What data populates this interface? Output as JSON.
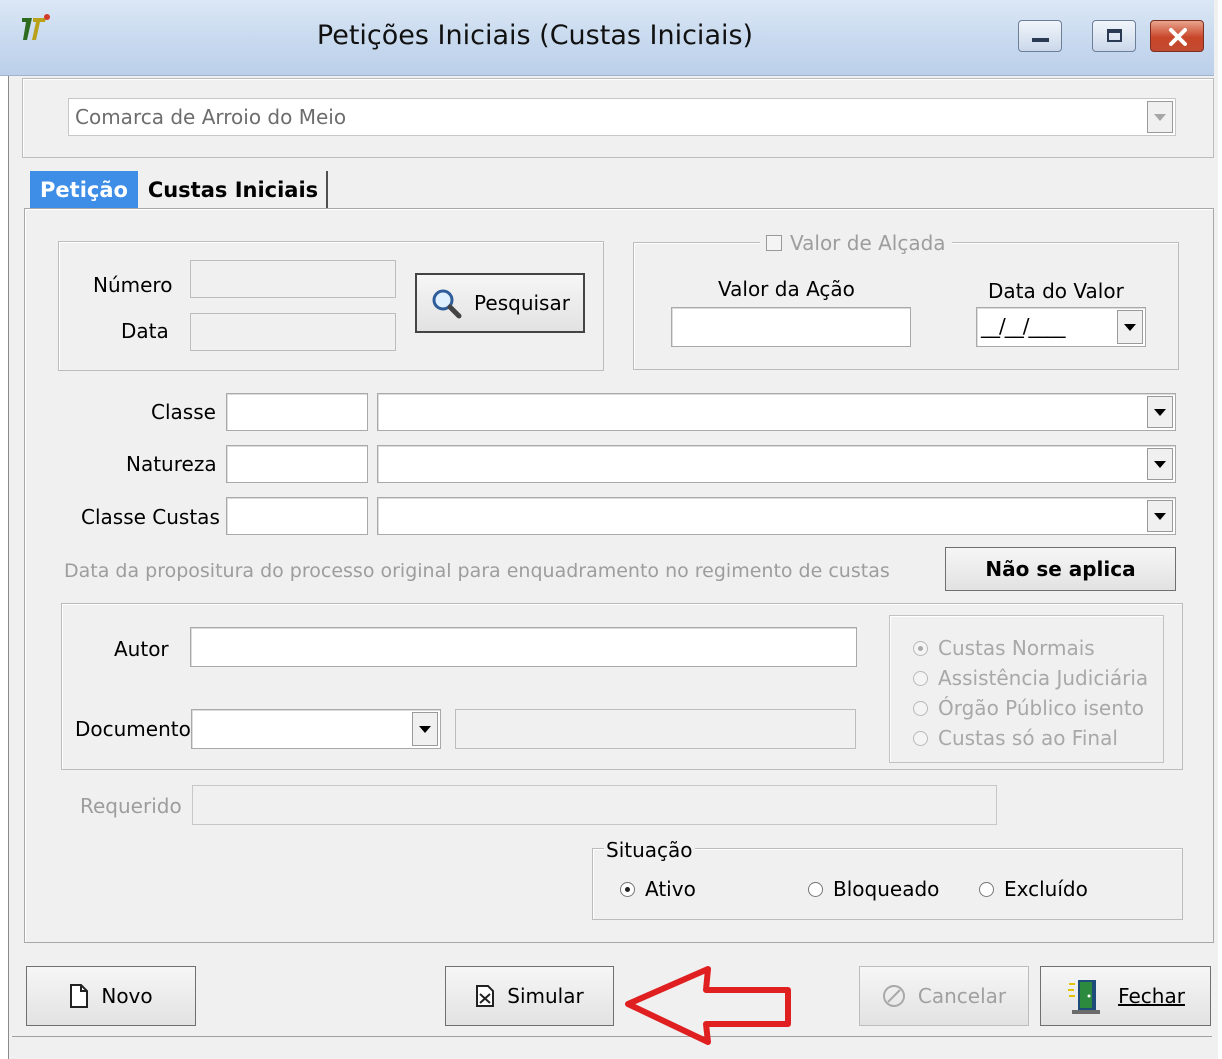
{
  "window": {
    "title": "Petições Iniciais (Custas Iniciais)"
  },
  "comarca": {
    "value": "Comarca de Arroio do Meio"
  },
  "tabs": [
    {
      "label": "Petição"
    },
    {
      "label": "Custas Iniciais"
    }
  ],
  "peticao": {
    "numero_label": "Número",
    "data_label": "Data",
    "pesquisar_label": "Pesquisar",
    "valor_alcada_label": "Valor de Alçada",
    "valor_acao_label": "Valor da Ação",
    "data_valor_label": "Data do Valor",
    "data_valor_value": "__/__/____",
    "classe_label": "Classe",
    "natureza_label": "Natureza",
    "classe_custas_label": "Classe Custas",
    "propositura_text": "Data da propositura do processo original para enquadramento no regimento de custas",
    "nao_se_aplica_label": "Não se aplica",
    "autor_label": "Autor",
    "documento_label": "Documento",
    "custas_options": [
      {
        "label": "Custas Normais",
        "selected": true
      },
      {
        "label": "Assistência Judiciária",
        "selected": false
      },
      {
        "label": "Órgão Público isento",
        "selected": false
      },
      {
        "label": "Custas só ao Final",
        "selected": false
      }
    ],
    "requerido_label": "Requerido",
    "situacao_label": "Situação",
    "situacao_options": [
      {
        "label": "Ativo",
        "selected": true
      },
      {
        "label": "Bloqueado",
        "selected": false
      },
      {
        "label": "Excluído",
        "selected": false
      }
    ]
  },
  "footer": {
    "novo_label": "Novo",
    "simular_label": "Simular",
    "cancelar_label": "Cancelar",
    "fechar_label": "Fechar"
  },
  "colors": {
    "tab_active": "#3e8ee8",
    "annotation_arrow": "#e02020"
  }
}
